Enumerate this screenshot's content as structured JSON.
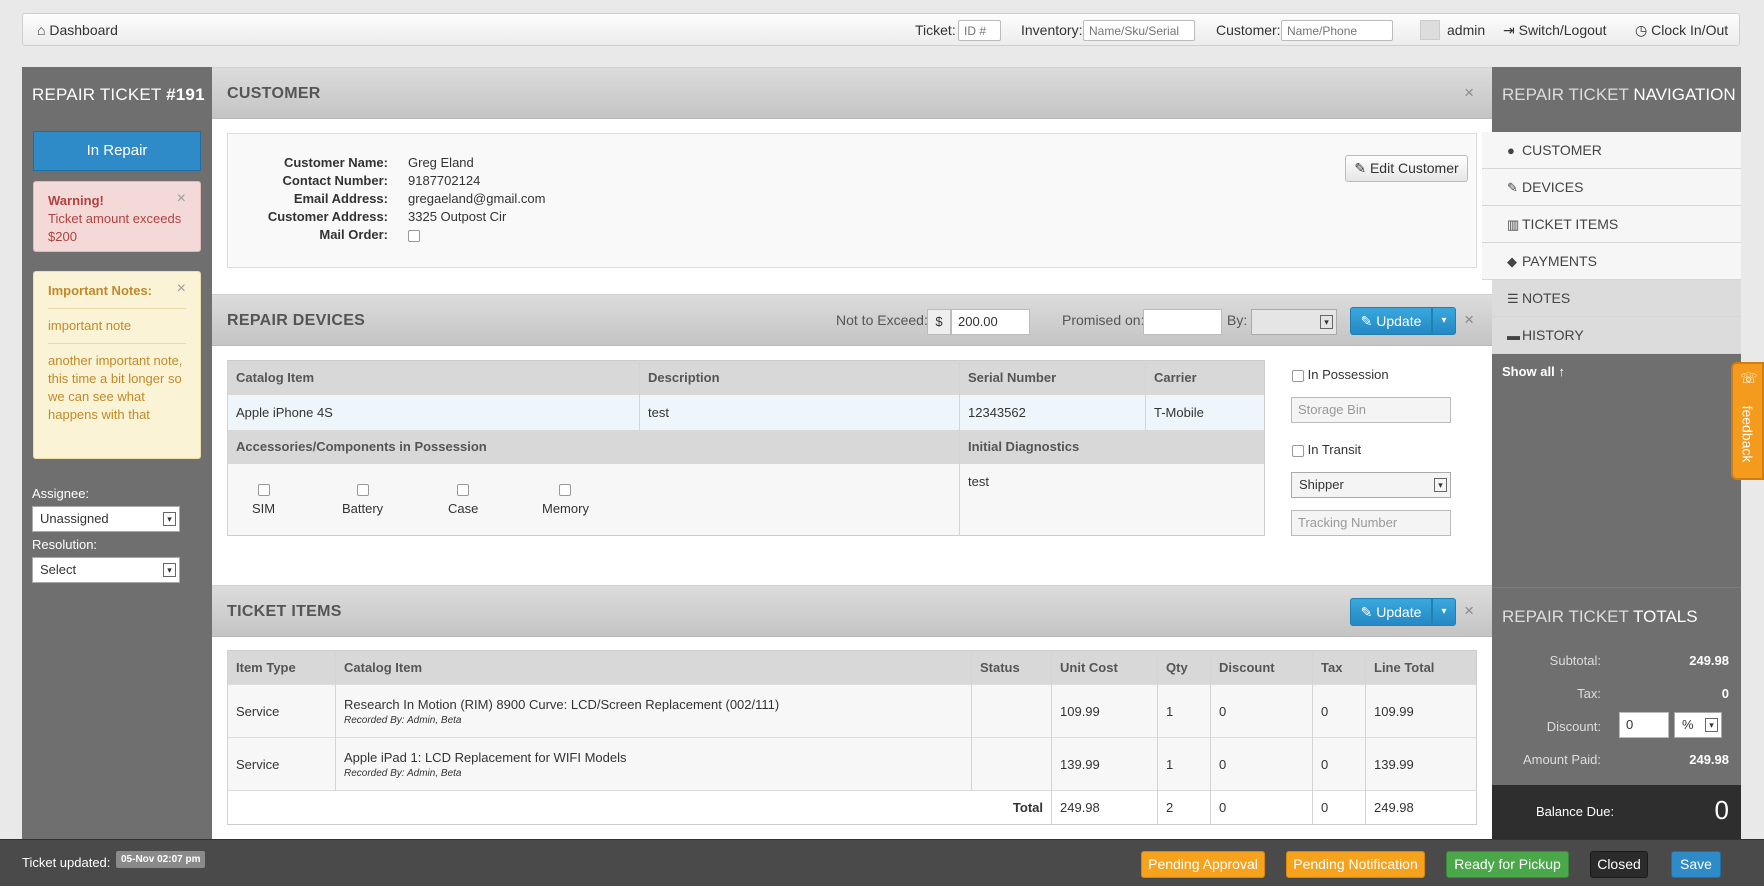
{
  "topbar": {
    "dashboard_label": "Dashboard",
    "ticket_label": "Ticket:",
    "ticket_placeholder": "ID #",
    "inventory_label": "Inventory:",
    "inventory_placeholder": "Name/Sku/Serial",
    "customer_label": "Customer:",
    "customer_placeholder": "Name/Phone",
    "user": "admin",
    "switch_logout": "Switch/Logout",
    "clock": "Clock In/Out"
  },
  "left": {
    "title_prefix": "REPAIR TICKET",
    "title_number": "#191",
    "status_label": "In Repair",
    "warning_title": "Warning!",
    "warning_text": "Ticket amount exceeds $200",
    "notes_title": "Important Notes:",
    "note_1": "important note",
    "note_2": "another important note, this time a bit longer so we can see what happens with that",
    "assignee_label": "Assignee:",
    "assignee_value": "Unassigned",
    "resolution_label": "Resolution:",
    "resolution_value": "Select"
  },
  "customer": {
    "title": "CUSTOMER",
    "name_label": "Customer Name:",
    "name": "Greg Eland",
    "contact_label": "Contact Number:",
    "contact": "9187702124",
    "email_label": "Email Address:",
    "email": "gregaeland@gmail.com",
    "address_label": "Customer Address:",
    "address": "3325 Outpost Cir",
    "mail_order_label": "Mail Order:",
    "edit_label": "Edit Customer"
  },
  "devices": {
    "title": "REPAIR DEVICES",
    "nte_label": "Not to Exceed:",
    "currency": "$",
    "nte_value": "200.00",
    "promised_label": "Promised on:",
    "by_label": "By:",
    "update_label": "Update",
    "headers": [
      "Catalog Item",
      "Description",
      "Serial Number",
      "Carrier"
    ],
    "row": [
      "Apple iPhone 4S",
      "test",
      "12343562",
      "T-Mobile"
    ],
    "accessories_label": "Accessories/Components in Possession",
    "diagnostics_label": "Initial Diagnostics",
    "diagnostics_value": "test",
    "components": [
      "SIM",
      "Battery",
      "Case",
      "Memory"
    ],
    "in_possession": "In Possession",
    "storage_placeholder": "Storage Bin",
    "in_transit": "In Transit",
    "shipper": "Shipper",
    "tracking_placeholder": "Tracking Number"
  },
  "items": {
    "title": "TICKET ITEMS",
    "update_label": "Update",
    "headers": [
      "Item Type",
      "Catalog Item",
      "Status",
      "Unit Cost",
      "Qty",
      "Discount",
      "Tax",
      "Line Total"
    ],
    "rows": [
      {
        "type": "Service",
        "item": "Research In Motion (RIM) 8900 Curve: LCD/Screen Replacement (002/111)",
        "recorded": "Recorded By: Admin, Beta",
        "status": "",
        "cost": "109.99",
        "qty": "1",
        "discount": "0",
        "tax": "0",
        "total": "109.99"
      },
      {
        "type": "Service",
        "item": "Apple iPad 1: LCD Replacement for WIFI Models",
        "recorded": "Recorded By: Admin, Beta",
        "status": "",
        "cost": "139.99",
        "qty": "1",
        "discount": "0",
        "tax": "0",
        "total": "139.99"
      }
    ],
    "total_label": "Total",
    "total_cost": "249.98",
    "total_qty": "2",
    "total_discount": "0",
    "total_tax": "0",
    "total_line": "249.98"
  },
  "nav": {
    "title_prefix": "REPAIR TICKET",
    "title_bold": "NAVIGATION",
    "items": [
      "CUSTOMER",
      "DEVICES",
      "TICKET ITEMS",
      "PAYMENTS",
      "NOTES",
      "HISTORY"
    ],
    "show_all": "Show all"
  },
  "totals": {
    "title_prefix": "REPAIR TICKET",
    "title_bold": "TOTALS",
    "subtotal_label": "Subtotal:",
    "subtotal": "249.98",
    "tax_label": "Tax:",
    "tax": "0",
    "discount_label": "Discount:",
    "discount_value": "0",
    "discount_unit": "%",
    "paid_label": "Amount Paid:",
    "paid": "249.98",
    "balance_label": "Balance Due:",
    "balance": "0"
  },
  "feedback": "feedback",
  "footer": {
    "updated_label": "Ticket updated:",
    "updated_value": "05-Nov 02:07 pm",
    "pending_approval": "Pending Approval",
    "pending_notification": "Pending Notification",
    "ready": "Ready for Pickup",
    "closed": "Closed",
    "save": "Save"
  },
  "colors": {
    "primary": "#2f8bc7",
    "orange": "#f49a1d",
    "green": "#4aa84a",
    "dark": "#4a4a4a"
  }
}
